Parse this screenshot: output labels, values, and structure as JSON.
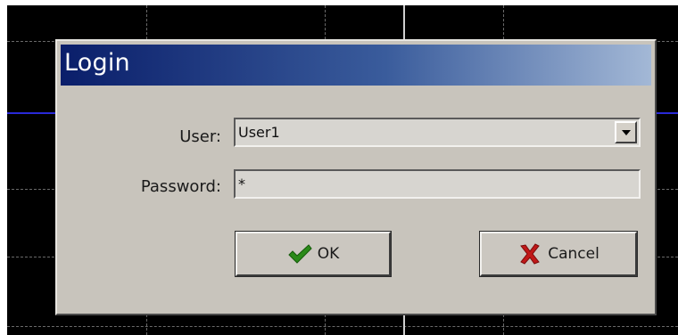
{
  "dialog": {
    "title": "Login",
    "user_label": "User:",
    "user_value": "User1",
    "password_label": "Password:",
    "password_value": "*",
    "ok_label": "OK",
    "cancel_label": "Cancel"
  },
  "icons": {
    "ok": "checkmark-icon",
    "cancel": "x-icon",
    "dropdown": "chevron-down-icon"
  },
  "colors": {
    "title_gradient_start": "#0a1e6a",
    "title_gradient_end": "#a3b8d6",
    "checkmark": "#2a8a18",
    "cross": "#c01818",
    "trace": "#2a2ad8"
  }
}
